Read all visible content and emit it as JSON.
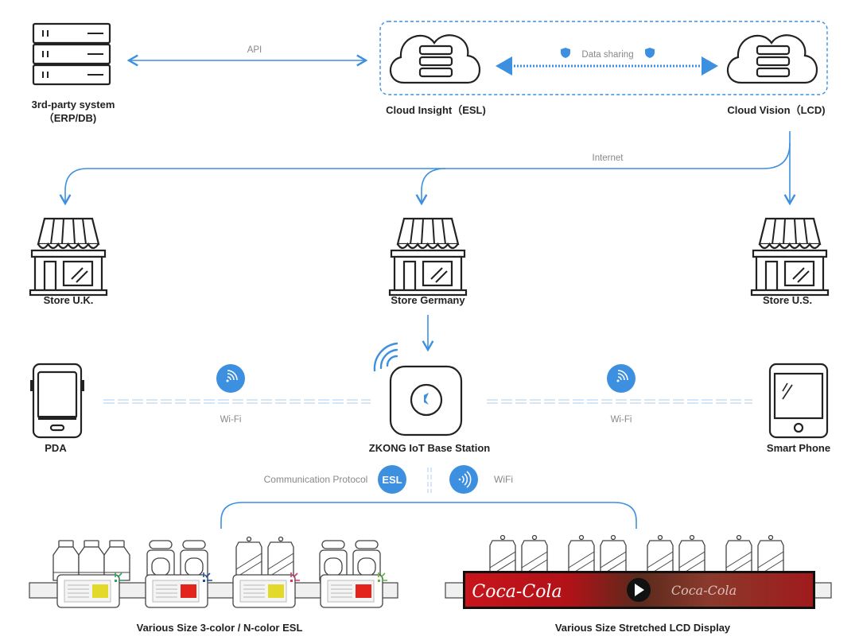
{
  "top": {
    "third_party": {
      "line1": "3rd-party system",
      "line2": "（ERP/DB)"
    },
    "api_label": "API",
    "cloud_insight": "Cloud Insight（ESL)",
    "cloud_vision": "Cloud Vision（LCD)",
    "data_sharing": "Data sharing",
    "internet": "Internet"
  },
  "stores": [
    {
      "label": "Store U.K."
    },
    {
      "label": "Store Germany"
    },
    {
      "label": "Store U.S."
    }
  ],
  "devices": {
    "pda": "PDA",
    "base_station": "ZKONG IoT Base Station",
    "smart_phone": "Smart Phone",
    "wifi_left": "Wi-Fi",
    "wifi_right": "Wi-Fi"
  },
  "protocol": {
    "label": "Communication Protocol",
    "esl_badge": "ESL",
    "wifi_label": "WiFi"
  },
  "bottom": {
    "esl_caption": "Various Size 3-color / N-color ESL",
    "lcd_caption": "Various Size Stretched LCD Display",
    "lcd_brand": "Coca-Cola"
  },
  "colors": {
    "accent": "#3d8fe0",
    "esl_yellow": "#e3d92a",
    "esl_red": "#e3241c",
    "lcd_red": "#c8141c"
  }
}
